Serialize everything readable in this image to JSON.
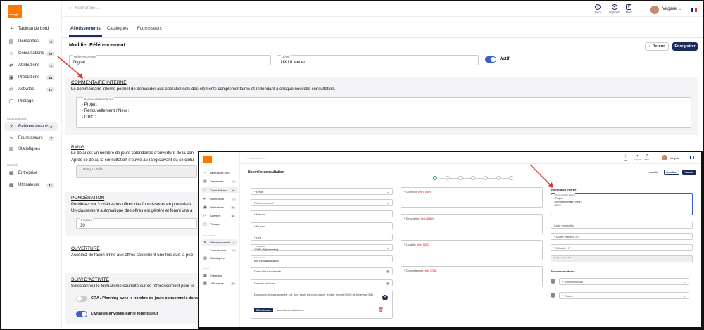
{
  "app": {
    "logo_text": "orange",
    "search_placeholder": "Recherche...",
    "user": "Virginie",
    "topbar": [
      {
        "icon": "info-icon",
        "label": "Info"
      },
      {
        "icon": "support-icon",
        "label": "Support"
      },
      {
        "icon": "pilot-icon",
        "label": "Pilot"
      }
    ]
  },
  "sidebar": {
    "items": [
      {
        "icon": "dashboard-icon",
        "label": "Tableau de bord",
        "count": ""
      },
      {
        "icon": "requests-icon",
        "label": "Demandes",
        "count": "2"
      },
      {
        "icon": "star-icon",
        "label": "Consultations",
        "count": "25"
      },
      {
        "icon": "attributions-icon",
        "label": "Attributions",
        "count": "1"
      },
      {
        "icon": "services-icon",
        "label": "Prestations",
        "count": "14"
      },
      {
        "icon": "activities-icon",
        "label": "Activités",
        "count": "21"
      },
      {
        "icon": "steering-icon",
        "label": "Pilotage",
        "count": ""
      }
    ],
    "section_sourcing": "Sous-traitants",
    "items2": [
      {
        "icon": "referencing-icon",
        "label": "Référencements",
        "count": "2"
      },
      {
        "icon": "suppliers-icon",
        "label": "Fournisseurs",
        "count": "7"
      },
      {
        "icon": "stats-icon",
        "label": "Statistiques",
        "count": ""
      }
    ],
    "section_company": "Société",
    "items3": [
      {
        "icon": "company-icon",
        "label": "Entreprise",
        "count": ""
      },
      {
        "icon": "users-icon",
        "label": "Utilisateurs",
        "count": "11"
      }
    ]
  },
  "tabs": [
    "Allotissements",
    "Catalogues",
    "Fournisseurs"
  ],
  "page": {
    "title": "Modifier Référencement",
    "back": "Retour",
    "save": "Enregistrer",
    "ref_label": "Référencement",
    "ref_value": "Digital",
    "detail_label": "Détail",
    "detail_value": "UX UI Métier",
    "active_label": "Actif"
  },
  "sections": {
    "comment": {
      "title": "COMMENTAIRE INTERNE",
      "desc": "Le commentaire interne permet de demander aux opérationnels des éléments complémentaires et redondant à chaque nouvelle consultation.",
      "box_label": "Commentaire interne",
      "lines": [
        "- Projet :",
        "- Renouvellement / New :",
        "- OPC :"
      ]
    },
    "rank": {
      "title": "RANG",
      "desc1": "Le délai est un nombre de jours calendaires d'ouverture de la con",
      "desc2": "Après ce délai, la consultation s'ouvre au rang suivant ou se clôtu",
      "field": "Rang 1 - Délai"
    },
    "weight": {
      "title": "PONDÉRATION",
      "desc1": "Pondérez sur 3 critères les offres des fournisseurs en procédant",
      "desc2": "Un classement automatique des offres est généré et fourni une a",
      "field_label": "Finance",
      "field_value": "30"
    },
    "open": {
      "title": "OUVERTURE",
      "desc": "Accédez de façon limité aux offres seulement une fois que la pub"
    },
    "follow": {
      "title": "SUIVI D'ACTIVITÉ",
      "desc": "Sélectionnez le formalisme souhaité sur ce référencement pour le",
      "opt1": "CRA / Planning avec le nombre de jours consommés dans le m",
      "opt2": "Livrables envoyés par le fournisseur"
    }
  },
  "overlay": {
    "title": "Nouvelle consultation",
    "cancel": "Annuler",
    "draft": "Brouillon",
    "save": "Sauver",
    "left": [
      "* Entité",
      "Référencement",
      "* Mission",
      "* Niveau",
      "* Lieu"
    ],
    "freq_label": "* Fréquence",
    "freq_value": "100% (5 j/semaine)",
    "dist_label": "* Distanciel",
    "dist_value": "0% (non applicable)",
    "date1": "Date début souhaitée",
    "date2": "Date fin estimée",
    "docs": "Documents (formats acceptés : pdf, jpeg, excel, word, ppt, pages, number, keynote) Taille de fichier max 5Mo",
    "select_btn": "Sélectionner",
    "no_file": "Aucun fichier sélectionné",
    "mid": [
      {
        "label": "* Contexte",
        "limit": "(min 0/50)"
      },
      {
        "label": "* Description",
        "limit": "(min 0/50)"
      },
      {
        "label": "* Livrable",
        "limit": "(min 0/20)"
      },
      {
        "label": "* Compétences",
        "limit": "(min 0/20)"
      }
    ],
    "info_title": "Information interne",
    "comment_label": "Commentaire interne",
    "comment_lines": [
      "- Projet :",
      "- Renouvellement / New :",
      "- OPC :"
    ],
    "right": [
      "Code imputation",
      "* Durée estimée JH",
      "TJM cible HT",
      "Budget estimé HT"
    ],
    "process_title": "Processus interne",
    "proc1": "* Sélectionneurs",
    "proc2": "* Pilotes"
  }
}
